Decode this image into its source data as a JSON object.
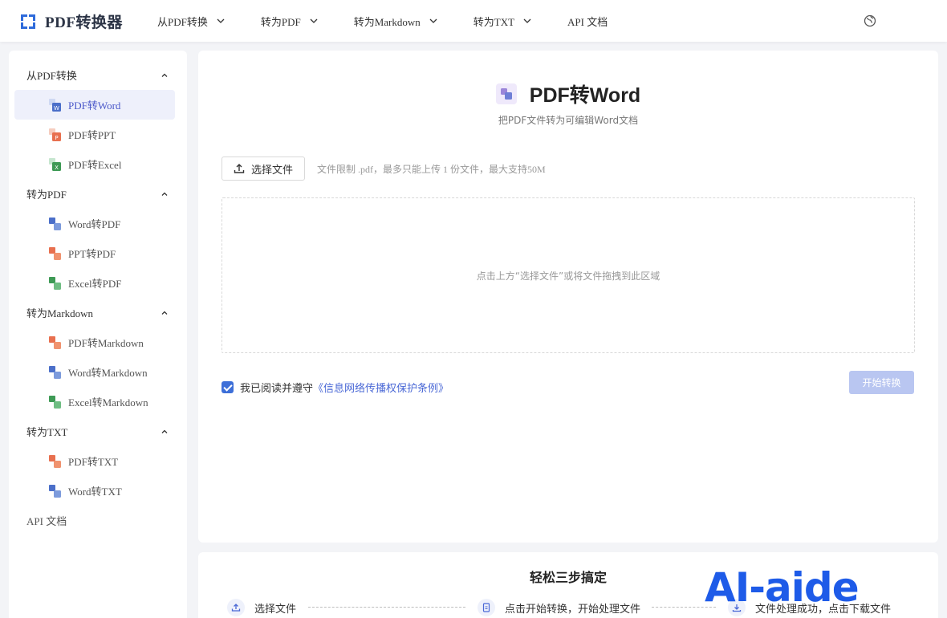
{
  "brand": {
    "name": "PDF转换器"
  },
  "nav": {
    "items": [
      {
        "label": "从PDF转换"
      },
      {
        "label": "转为PDF"
      },
      {
        "label": "转为Markdown"
      },
      {
        "label": "转为TXT"
      },
      {
        "label": "API 文档"
      }
    ]
  },
  "sidebar": {
    "groups": [
      {
        "label": "从PDF转换",
        "items": [
          {
            "label": "PDF转Word"
          },
          {
            "label": "PDF转PPT"
          },
          {
            "label": "PDF转Excel"
          }
        ]
      },
      {
        "label": "转为PDF",
        "items": [
          {
            "label": "Word转PDF"
          },
          {
            "label": "PPT转PDF"
          },
          {
            "label": "Excel转PDF"
          }
        ]
      },
      {
        "label": "转为Markdown",
        "items": [
          {
            "label": "PDF转Markdown"
          },
          {
            "label": "Word转Markdown"
          },
          {
            "label": "Excel转Markdown"
          }
        ]
      },
      {
        "label": "转为TXT",
        "items": [
          {
            "label": "PDF转TXT"
          },
          {
            "label": "Word转TXT"
          }
        ]
      }
    ],
    "api_doc": "API 文档"
  },
  "main": {
    "title": "PDF转Word",
    "subtitle": "把PDF文件转为可编辑Word文档",
    "upload_label": "选择文件",
    "upload_hint": "文件限制 .pdf，最多只能上传 1 份文件，最大支持50M",
    "dropzone_text": "点击上方“选择文件”或将文件拖拽到此区域",
    "agree_text": "我已阅读并遵守",
    "agree_link": "《信息网络传播权保护条例》",
    "start_label": "开始转换"
  },
  "steps": {
    "title": "轻松三步搞定",
    "items": [
      {
        "label": "选择文件"
      },
      {
        "label": "点击开始转换，开始处理文件"
      },
      {
        "label": "文件处理成功，点击下载文件"
      }
    ]
  },
  "watermark": "AI-aide",
  "colors": {
    "accent": "#4a57c9",
    "primary": "#3d6fd8",
    "disabled_btn": "#b9c6f1",
    "word": "#4b6fc9",
    "ppt": "#e8704f",
    "excel": "#3e9a55"
  }
}
